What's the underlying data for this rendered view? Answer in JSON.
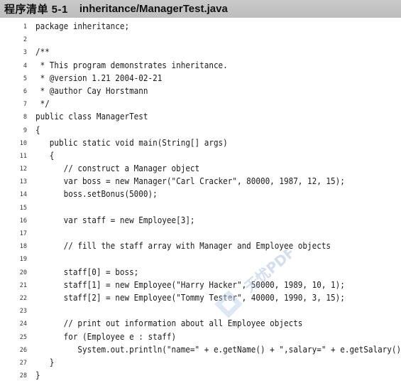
{
  "header": {
    "label": "程序清单 5-1",
    "filename": "inheritance/ManagerTest.java"
  },
  "code_lines": [
    {
      "n": "1",
      "text": "package inheritance;"
    },
    {
      "n": "2",
      "text": ""
    },
    {
      "n": "3",
      "text": "/**"
    },
    {
      "n": "4",
      "text": " * This program demonstrates inheritance."
    },
    {
      "n": "5",
      "text": " * @version 1.21 2004-02-21"
    },
    {
      "n": "6",
      "text": " * @author Cay Horstmann"
    },
    {
      "n": "7",
      "text": " */"
    },
    {
      "n": "8",
      "text": "public class ManagerTest"
    },
    {
      "n": "9",
      "text": "{"
    },
    {
      "n": "10",
      "text": "   public static void main(String[] args)"
    },
    {
      "n": "11",
      "text": "   {"
    },
    {
      "n": "12",
      "text": "      // construct a Manager object"
    },
    {
      "n": "13",
      "text": "      var boss = new Manager(\"Carl Cracker\", 80000, 1987, 12, 15);"
    },
    {
      "n": "14",
      "text": "      boss.setBonus(5000);"
    },
    {
      "n": "15",
      "text": ""
    },
    {
      "n": "16",
      "text": "      var staff = new Employee[3];"
    },
    {
      "n": "17",
      "text": ""
    },
    {
      "n": "18",
      "text": "      // fill the staff array with Manager and Employee objects"
    },
    {
      "n": "19",
      "text": ""
    },
    {
      "n": "20",
      "text": "      staff[0] = boss;"
    },
    {
      "n": "21",
      "text": "      staff[1] = new Employee(\"Harry Hacker\", 50000, 1989, 10, 1);"
    },
    {
      "n": "22",
      "text": "      staff[2] = new Employee(\"Tommy Tester\", 40000, 1990, 3, 15);"
    },
    {
      "n": "23",
      "text": ""
    },
    {
      "n": "24",
      "text": "      // print out information about all Employee objects"
    },
    {
      "n": "25",
      "text": "      for (Employee e : staff)"
    },
    {
      "n": "26",
      "text": "         System.out.println(\"name=\" + e.getName() + \",salary=\" + e.getSalary());"
    },
    {
      "n": "27",
      "text": "   }"
    },
    {
      "n": "28",
      "text": "}"
    }
  ],
  "watermark": {
    "text": "无忧PDF",
    "color": "#9ab3d8"
  }
}
